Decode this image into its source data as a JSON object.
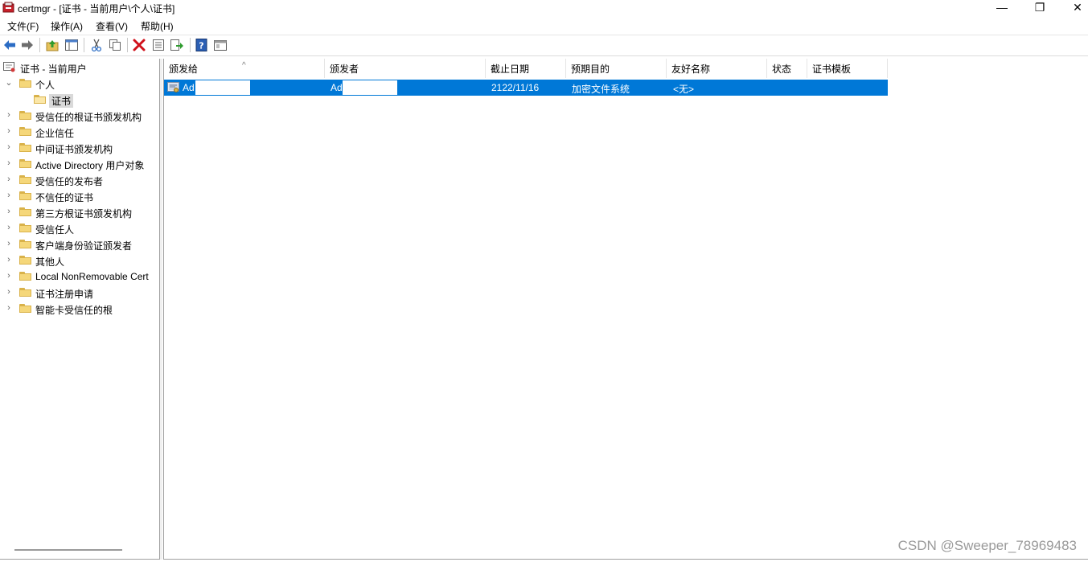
{
  "window": {
    "title": "certmgr - [证书 - 当前用户\\个人\\证书]",
    "controls": {
      "minimize": "—",
      "maximize": "❐",
      "close": "✕"
    }
  },
  "menu": [
    "文件(F)",
    "操作(A)",
    "查看(V)",
    "帮助(H)"
  ],
  "toolbar": {
    "icons": [
      "back-arrow-icon",
      "forward-arrow-icon",
      "up-folder-icon",
      "show-hide-tree-icon",
      "cut-icon",
      "copy-icon",
      "delete-icon",
      "properties-icon",
      "export-list-icon",
      "help-icon",
      "mmc-console-icon"
    ]
  },
  "tree": {
    "root": "证书 - 当前用户",
    "personal": "个人",
    "personal_child": "证书",
    "items": [
      "受信任的根证书颁发机构",
      "企业信任",
      "中间证书颁发机构",
      "Active Directory 用户对象",
      "受信任的发布者",
      "不信任的证书",
      "第三方根证书颁发机构",
      "受信任人",
      "客户端身份验证颁发者",
      "其他人",
      "Local NonRemovable Cert",
      "证书注册申请",
      "智能卡受信任的根"
    ]
  },
  "list": {
    "columns": [
      "颁发给",
      "颁发者",
      "截止日期",
      "预期目的",
      "友好名称",
      "状态",
      "证书模板"
    ],
    "sort_indicator": "^",
    "rows": [
      {
        "issued_to": "Ad",
        "issued_by": "Ad",
        "expiration": "2122/11/16",
        "purpose": "加密文件系统",
        "friendly_name": "<无>",
        "status": "",
        "template": ""
      }
    ]
  },
  "watermark": "CSDN @Sweeper_78969483",
  "colors": {
    "selection": "#0078d7",
    "folder": "#f5d77a",
    "delete_red": "#d0101a"
  }
}
